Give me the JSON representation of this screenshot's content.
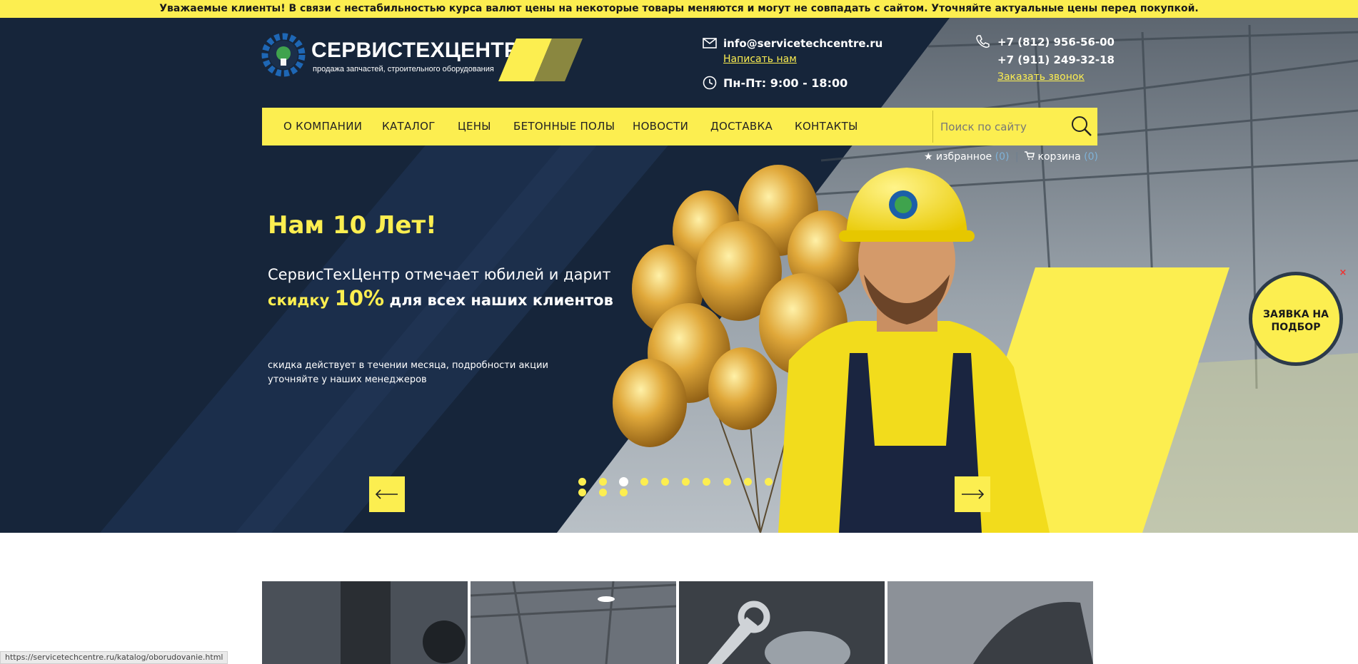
{
  "notice": "Уважаемые клиенты! В связи с нестабильностью курса валют цены на некоторые товары меняются и могут не совпадать с сайтом. Уточняйте актуальные цены перед покупкой.",
  "logo": {
    "title": "СЕРВИСТЕХЦЕНТР",
    "subtitle": "продажа запчастей, строительного оборудования"
  },
  "contacts": {
    "email": "info@servicetechcentre.ru",
    "write_link": "Написать нам",
    "hours": "Пн-Пт: 9:00 - 18:00",
    "phone1": "+7 (812) 956-56-00",
    "phone2": "+7 (911) 249-32-18",
    "callback_link": "Заказать звонок"
  },
  "nav": {
    "items": [
      "О КОМПАНИИ",
      "КАТАЛОГ",
      "ЦЕНЫ",
      "БЕТОННЫЕ ПОЛЫ",
      "НОВОСТИ",
      "ДОСТАВКА",
      "КОНТАКТЫ"
    ],
    "search_placeholder": "Поиск по сайту"
  },
  "user_links": {
    "favorites_label": "избранное",
    "favorites_count": "(0)",
    "cart_label": "корзина",
    "cart_count": "(0)"
  },
  "hero": {
    "title": "Нам 10 Лет!",
    "line1": "СервисТехЦентр отмечает юбилей и дарит",
    "line2_a": "скидку",
    "line2_b": "10%",
    "line2_c": "для всех наших клиентов",
    "note": "скидка действует в течении месяца, подробности акции уточняйте у наших менеджеров",
    "prev_icon": "arrow-left-icon",
    "next_icon": "arrow-right-icon",
    "slide_count": 13,
    "active_slide": 3
  },
  "badge": {
    "text": "ЗАЯВКА НА ПОДБОР",
    "close": "×"
  },
  "status_url": "https://servicetechcentre.ru/katalog/oborudovanie.html",
  "colors": {
    "accent": "#fcee50",
    "dark": "#16253a",
    "link_count": "#7fb2d8"
  }
}
